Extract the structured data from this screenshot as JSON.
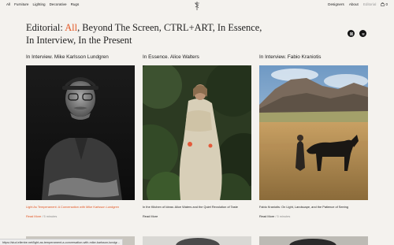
{
  "nav": {
    "left": [
      "All",
      "Furniture",
      "Lighting",
      "Decorative",
      "Rugs"
    ],
    "designers": "Designers",
    "about": "About",
    "editorial": "Editorial",
    "cart_count": "0"
  },
  "heading": {
    "prefix": "Editorial: ",
    "active": "All",
    "rest": ", Beyond The Screen, CTRL+ART, In Essence, In Interview, In the Present"
  },
  "social": [
    "instagram-icon",
    "spotify-icon"
  ],
  "articles": [
    {
      "title": "In Interview. Mike Karlsson Lundgren",
      "caption": "Light As Temperament: A Conversation with Mike Karlsson Lundgren",
      "read_more": "Read More",
      "duration": "/ 5 minutes"
    },
    {
      "title": "In Essence. Alice Walters",
      "caption": "In the Kitchen of Ideas: Alice Waters and the Quiet Revolution of Taste",
      "read_more": "Read More",
      "duration": ""
    },
    {
      "title": "In Interview. Fabio Kraniotis",
      "caption": "Fabio Kraniotis: On Light, Landscape, and the Patience of Seeing",
      "read_more": "Read More",
      "duration": "/ 5 minutes"
    }
  ],
  "status_url": "https://stud.ellenbe.net/light-as-temperament-a-conversation-with-mike-karlsson-lundgr...",
  "colors": {
    "accent": "#e25522",
    "background": "#f4f2ee"
  }
}
